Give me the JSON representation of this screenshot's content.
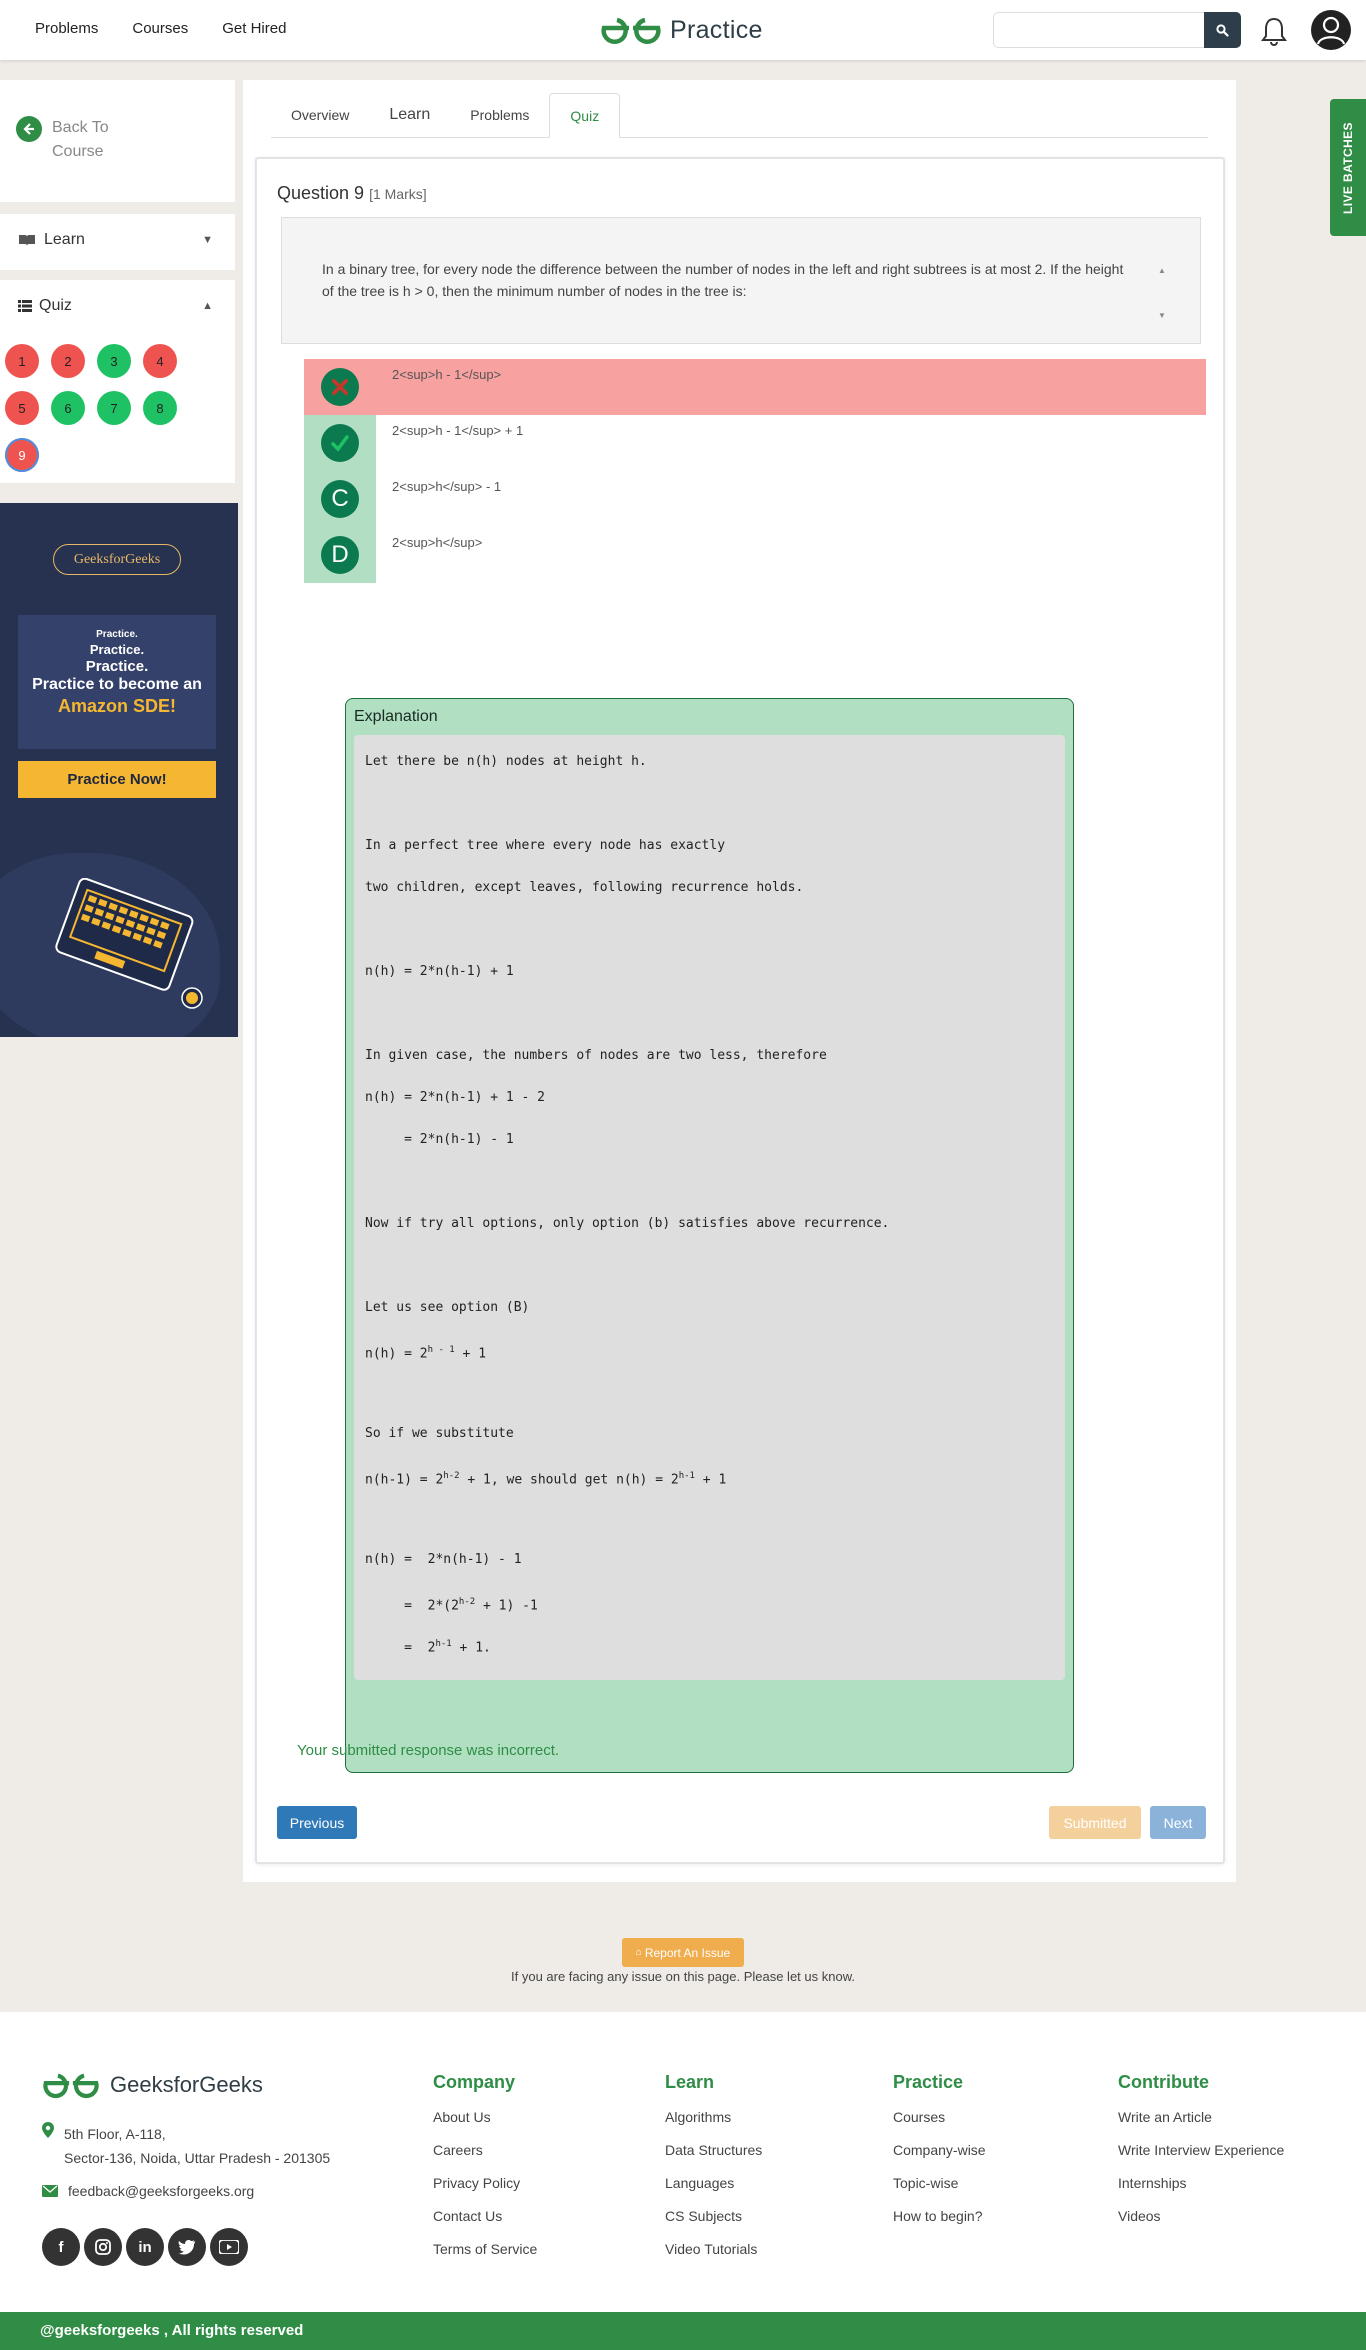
{
  "header": {
    "nav": [
      "Problems",
      "Courses",
      "Get Hired"
    ],
    "brand": "Practice",
    "search_placeholder": ""
  },
  "sidebar": {
    "back": "Back To Course",
    "learn": "Learn",
    "quiz": "Quiz",
    "questions": [
      {
        "n": "1",
        "status": "wrong"
      },
      {
        "n": "2",
        "status": "wrong"
      },
      {
        "n": "3",
        "status": "correct"
      },
      {
        "n": "4",
        "status": "wrong"
      },
      {
        "n": "5",
        "status": "wrong"
      },
      {
        "n": "6",
        "status": "correct"
      },
      {
        "n": "7",
        "status": "correct"
      },
      {
        "n": "8",
        "status": "correct"
      },
      {
        "n": "9",
        "status": "current"
      }
    ]
  },
  "ad": {
    "badge": "GeeksforGeeks",
    "line1": "Practice.",
    "line2": "Practice.",
    "line3": "Practice.",
    "line4": "Practice to become an",
    "line5": "Amazon SDE!",
    "cta": "Practice Now!"
  },
  "tabs": [
    "Overview",
    "Learn",
    "Problems",
    "Quiz"
  ],
  "question": {
    "title": "Question 9",
    "marks": "[1 Marks]",
    "text": "In a binary tree, for every node the difference between the number of nodes in the left and right subtrees is at most 2. If the height of the tree is h > 0, then the minimum number of nodes in the tree is:",
    "options": [
      {
        "badge": "✗",
        "text": "2<sup>h - 1</sup>",
        "state": "wrong"
      },
      {
        "badge": "✓",
        "text": "2<sup>h - 1</sup> + 1",
        "state": "correct"
      },
      {
        "badge": "C",
        "text": "2<sup>h</sup> - 1",
        "state": "none"
      },
      {
        "badge": "D",
        "text": "2<sup>h</sup>",
        "state": "none"
      }
    ]
  },
  "explanation": {
    "title": "Explanation",
    "lines": [
      "Let there be n(h) nodes at height h.",
      "",
      "In a perfect tree where every node has exactly",
      "two children, except leaves, following recurrence holds.",
      "",
      "n(h) = 2*n(h-1) + 1",
      "",
      "In given case, the numbers of nodes are two less, therefore",
      "n(h) = 2*n(h-1) + 1 - 2",
      "     = 2*n(h-1) - 1",
      "",
      "Now if try all options, only option (b) satisfies above recurrence.",
      "",
      "Let us see option (B)",
      "n(h) = 2^{h - 1} + 1",
      "",
      "So if we substitute",
      "n(h-1) = 2^{h-2} + 1, we should get n(h) = 2^{h-1} + 1",
      "",
      "n(h) =  2*n(h-1) - 1",
      "     =  2*(2^{h-2} + 1) -1",
      "     =  2^{h-1} + 1."
    ]
  },
  "result": "Your submitted response was incorrect.",
  "buttons": {
    "previous": "Previous",
    "submitted": "Submitted",
    "next": "Next"
  },
  "report": {
    "button": "Report An Issue",
    "note": "If you are facing any issue on this page. Please let us know."
  },
  "live_batches": "LIVE BATCHES",
  "footer": {
    "brand": "GeeksforGeeks",
    "address_line1": "5th Floor, A-118,",
    "address_line2": "Sector-136, Noida, Uttar Pradesh - 201305",
    "email": "feedback@geeksforgeeks.org",
    "social": [
      "f",
      "ig",
      "in",
      "tw",
      "yt"
    ],
    "columns": [
      {
        "title": "Company",
        "links": [
          "About Us",
          "Careers",
          "Privacy Policy",
          "Contact Us",
          "Terms of Service"
        ]
      },
      {
        "title": "Learn",
        "links": [
          "Algorithms",
          "Data Structures",
          "Languages",
          "CS Subjects",
          "Video Tutorials"
        ]
      },
      {
        "title": "Practice",
        "links": [
          "Courses",
          "Company-wise",
          "Topic-wise",
          "How to begin?"
        ]
      },
      {
        "title": "Contribute",
        "links": [
          "Write an Article",
          "Write Interview Experience",
          "Internships",
          "Videos"
        ]
      }
    ],
    "copyright": "@geeksforgeeks , All rights reserved"
  },
  "colors": {
    "brand_green": "#2f8d46",
    "wrong_red": "#ef5350",
    "correct_green": "#1ec264"
  }
}
